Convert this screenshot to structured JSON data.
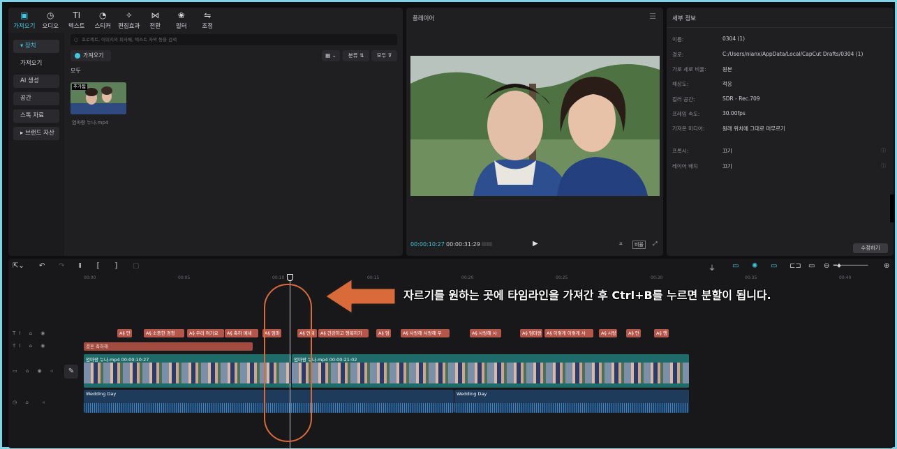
{
  "media_panel": {
    "tabs": [
      {
        "icon": "▣",
        "label": "가져오기",
        "active": true
      },
      {
        "icon": "◷",
        "label": "오디오"
      },
      {
        "icon": "TI",
        "label": "텍스트"
      },
      {
        "icon": "◔",
        "label": "스티커"
      },
      {
        "icon": "✧",
        "label": "편집효과"
      },
      {
        "icon": "⋈",
        "label": "전환"
      },
      {
        "icon": "❀",
        "label": "필터"
      },
      {
        "icon": "⇋",
        "label": "조정"
      }
    ],
    "nav": [
      "▾ 장치",
      "가져오기",
      "AI 생성",
      "공간",
      "스톡 자료",
      "▸ 브랜드 자산"
    ],
    "search_placeholder": "프로젝트, 이미지의 피사체, 텍스트 자막 등을 검색",
    "import_label": "가져오기",
    "view_btn": "▦ ⌄",
    "sort_btn": "분류 ⇅",
    "filter_btn": "모두 ⊽",
    "all_label": "모두",
    "thumb_badge": "추가됨",
    "thumb_name": "엄마랑 누나.mp4"
  },
  "player": {
    "title": "플레이어",
    "current_time": "00:00:10:27",
    "total_time": "00:00:31:29",
    "ratio_btn": "비율"
  },
  "detail": {
    "title": "세부 정보",
    "rows": [
      {
        "k": "이름:",
        "v": "0304 (1)"
      },
      {
        "k": "경로:",
        "v": "C:/Users/nianx/AppData/Local/CapCut Drafts/0304 (1)"
      },
      {
        "k": "가로 세로 비율:",
        "v": "원본"
      },
      {
        "k": "해상도:",
        "v": "적응"
      },
      {
        "k": "컬러 공간:",
        "v": "SDR - Rec.709"
      },
      {
        "k": "프레임 속도:",
        "v": "30.00fps"
      },
      {
        "k": "가져온 미디어:",
        "v": "원래 위치에 그대로 머무르기"
      },
      {
        "k": "프록시:",
        "v": "끄기"
      },
      {
        "k": "레이어 배치",
        "v": "끄기"
      }
    ],
    "edit_btn": "수정하기"
  },
  "timeline": {
    "ruler": [
      "00:00",
      "00:05",
      "00:10",
      "00:15",
      "00:20",
      "00:25",
      "00:30",
      "00:35",
      "00:40"
    ],
    "text_clips": [
      "A§ 안",
      "A§ 소중한 경청",
      "A§ 우리 여기요",
      "A§ 축하 메세",
      "A§ 엄마",
      "A§ 언제",
      "A§ 건강하고 행복하기",
      "A§ 엄",
      "A§ 사랑해 사랑해 우",
      "A§ 사랑해 사",
      "A§ 엄마랑",
      "A§ 이렇게 이렇게 사",
      "A§ 사랑",
      "A§ 안",
      "A§ 행"
    ],
    "title_clip": "결혼 축하해",
    "video_clips": [
      {
        "label": "엄마랑 누나.mp4  00:00:10:27"
      },
      {
        "label": "엄마랑 누나.mp4  00:00:21:02"
      }
    ],
    "audio_clips": [
      "Wedding Day",
      "Wedding Day"
    ]
  },
  "annotation": "자르기를 원하는 곳에 타임라인을 가져간 후 Ctrl+B를 누르면 분할이 됩니다."
}
